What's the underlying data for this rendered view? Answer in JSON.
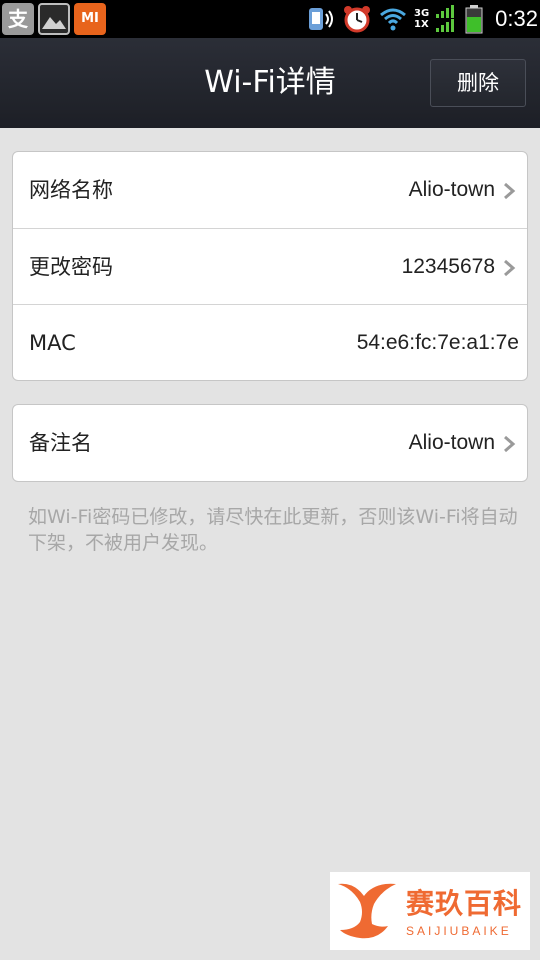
{
  "status_bar": {
    "alipay_icon_label": "支",
    "mi_icon_label": "MI",
    "network_top": "3G",
    "network_bottom": "1X",
    "time": "0:32",
    "icons": [
      "alipay-icon",
      "gallery-icon",
      "mi-icon",
      "phone-speaker-icon",
      "alarm-clock-icon",
      "wifi-icon",
      "signal-icon",
      "battery-icon"
    ]
  },
  "header": {
    "title": "Wi-Fi详情",
    "delete_label": "删除"
  },
  "details": {
    "rows": [
      {
        "label": "网络名称",
        "value": "Alio-town"
      },
      {
        "label": "更改密码",
        "value": "12345678"
      },
      {
        "label": "MAC",
        "value": "54:e6:fc:7e:a1:7e"
      }
    ]
  },
  "remark": {
    "label": "备注名",
    "value": "Alio-town"
  },
  "note": "如Wi-Fi密码已修改，请尽快在此更新，否则该Wi-Fi将自动下架，不被用户发现。",
  "watermark": {
    "title": "赛玖百科",
    "subtitle": "SAIJIUBAIKE"
  },
  "colors": {
    "title_bar": "#23262d",
    "background": "#e3e3e3",
    "accent": "#ef6a32",
    "battery": "#3fbf2a"
  }
}
